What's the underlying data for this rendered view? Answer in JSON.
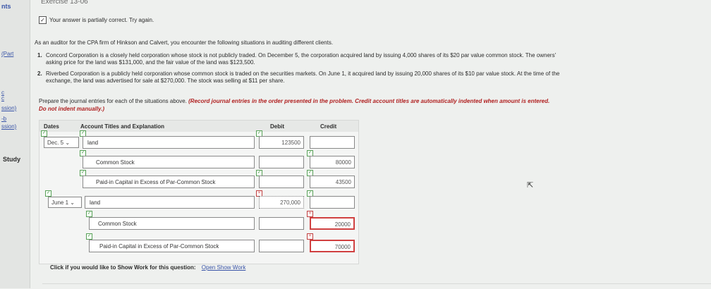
{
  "sidebar": {
    "items": [
      "nts",
      "(Part",
      "c",
      "c",
      "ssion)",
      "-b",
      "ssion)",
      "Study"
    ]
  },
  "exercise_title": "Exercise 13-06",
  "status_text": "Your answer is partially correct.  Try again.",
  "intro": "As an auditor for the CPA firm of Hinkson and Calvert, you encounter the following situations in auditing different clients.",
  "situations": [
    {
      "number": "1.",
      "line1": "Concord Corporation is a closely held corporation whose stock is not publicly traded. On December 5, the corporation acquired land by issuing 4,000 shares of its $20 par value common stock. The owners'",
      "line2": "asking price for the land was $131,000, and the fair value of the land was $123,500."
    },
    {
      "number": "2.",
      "line1": "Riverbed Corporation is a publicly held corporation whose common stock is traded on the securities markets. On June 1, it acquired land by issuing 20,000 shares of its $10 par value stock. At the time of the",
      "line2": "exchange, the land was advertised for sale at $270,000. The stock was selling at $11 per share."
    }
  ],
  "prepare": {
    "text": "Prepare the journal entries for each of the situations above.",
    "instruction_line1": "(Record journal entries in the order presented in the problem. Credit account titles are automatically indented when amount is entered.",
    "instruction_line2": "Do not indent manually.)"
  },
  "table": {
    "headers": {
      "dates": "Dates",
      "account": "Account Titles and Explanation",
      "debit": "Debit",
      "credit": "Credit"
    },
    "rows": [
      {
        "date": "Dec. 5",
        "account": "land",
        "debit": "123500",
        "credit": ""
      },
      {
        "date": "",
        "account": "Common Stock",
        "debit": "",
        "credit": "80000"
      },
      {
        "date": "",
        "account": "Paid-in Capital in Excess of Par-Common Stock",
        "debit": "",
        "credit": "43500"
      },
      {
        "date": "June 1",
        "account": "land",
        "debit": "270,000",
        "credit": ""
      },
      {
        "date": "",
        "account": "Common Stock",
        "debit": "",
        "credit": "20000"
      },
      {
        "date": "",
        "account": "Paid-in Capital in Excess of Par-Common Stock",
        "debit": "",
        "credit": "70000"
      }
    ]
  },
  "dropdown_arrow": "chevron-down-icon",
  "footer": {
    "text": "Click if you would like to Show Work for this question:",
    "link": "Open Show Work"
  },
  "colors": {
    "correct": "#58a058",
    "incorrect": "#d04040",
    "link": "#3a55a8",
    "instruction": "#b02020"
  }
}
